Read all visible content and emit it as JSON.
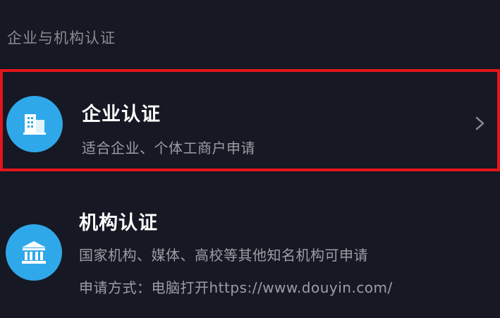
{
  "section": {
    "title": "企业与机构认证"
  },
  "items": [
    {
      "title": "企业认证",
      "desc": "适合企业、个体工商户申请",
      "icon": "building-icon"
    },
    {
      "title": "机构认证",
      "desc": "国家机构、媒体、高校等其他知名机构可申请",
      "desc2": "申请方式：电脑打开https://www.douyin.com/",
      "icon": "institution-icon"
    }
  ],
  "colors": {
    "background": "#161823",
    "accent_blue": "#2fa8ea",
    "highlight_red": "#e3161c"
  }
}
